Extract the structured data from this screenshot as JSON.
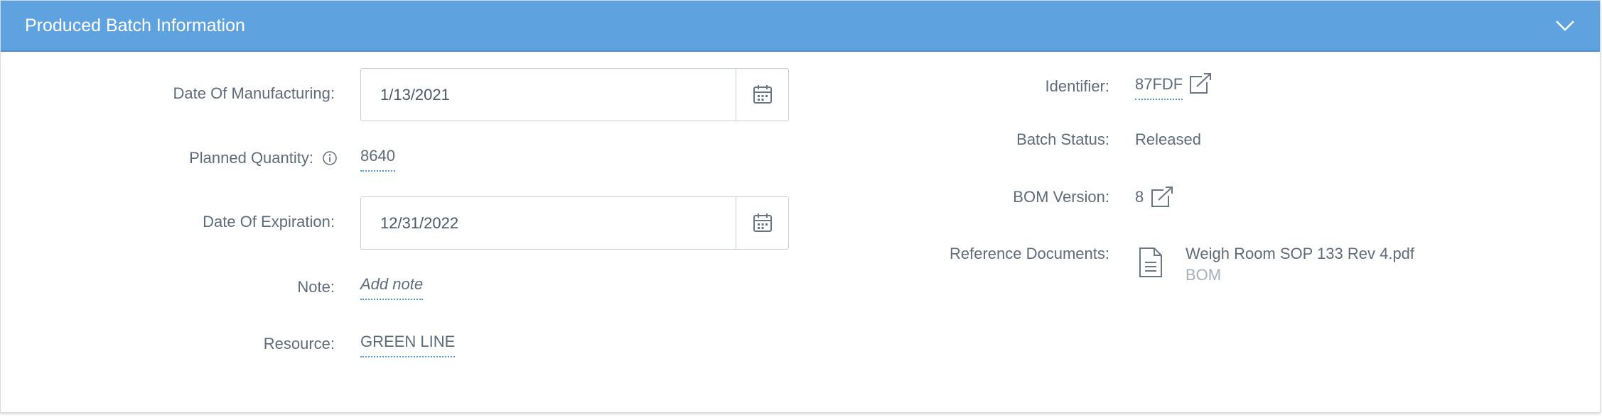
{
  "header": {
    "title": "Produced Batch Information",
    "collapse_icon": "chevron-down-icon",
    "background": "#5ea3df"
  },
  "left_fields": {
    "date_of_manufacturing": {
      "label": "Date Of Manufacturing:",
      "value": "1/13/2021"
    },
    "planned_quantity": {
      "label": "Planned Quantity:",
      "value": "8640",
      "info_icon": "info-icon"
    },
    "date_of_expiration": {
      "label": "Date Of Expiration:",
      "value": "12/31/2022"
    },
    "note": {
      "label": "Note:",
      "placeholder": "Add note"
    },
    "resource": {
      "label": "Resource:",
      "value": "GREEN LINE"
    }
  },
  "right_fields": {
    "identifier": {
      "label": "Identifier:",
      "value": "87FDF"
    },
    "batch_status": {
      "label": "Batch Status:",
      "value": "Released"
    },
    "bom_version": {
      "label": "BOM Version:",
      "value": "8"
    },
    "reference_documents": {
      "label": "Reference Documents:",
      "document": {
        "name": "Weigh Room SOP 133 Rev 4.pdf",
        "type": "BOM"
      }
    }
  },
  "colors": {
    "link_underline": "#4f9ad6",
    "text": "#5f6b7a",
    "muted": "#a6afb9"
  }
}
